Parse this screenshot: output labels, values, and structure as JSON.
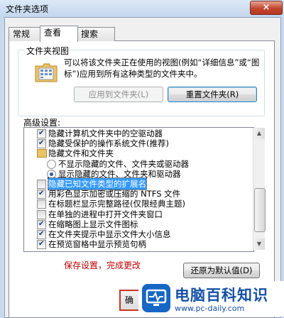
{
  "window": {
    "title": "文件夹选项",
    "close_label": "×"
  },
  "tabs": [
    {
      "label": "常规",
      "active": false
    },
    {
      "label": "查看",
      "active": true
    },
    {
      "label": "搜索",
      "active": false
    }
  ],
  "folder_views": {
    "label": "文件夹视图",
    "description": "可以将该文件夹正在使用的视图(例如“详细信息”或“图标”)应用到所有这种类型的文件夹中。",
    "apply_button": "应用到文件夹(L)",
    "reset_button": "重置文件夹(R)"
  },
  "advanced": {
    "label": "高级设置:",
    "items": [
      {
        "type": "checkbox",
        "checked": true,
        "level": 1,
        "label": "隐藏计算机文件夹中的空驱动器"
      },
      {
        "type": "checkbox",
        "checked": true,
        "level": 1,
        "label": "隐藏受保护的操作系统文件(推荐)"
      },
      {
        "type": "folder",
        "level": 1,
        "label": "隐藏文件和文件夹"
      },
      {
        "type": "radio",
        "checked": false,
        "level": 2,
        "label": "不显示隐藏的文件、文件夹或驱动器"
      },
      {
        "type": "radio",
        "checked": true,
        "level": 2,
        "label": "显示隐藏的文件、文件夹和驱动器"
      },
      {
        "type": "checkbox",
        "checked": false,
        "level": 1,
        "label": "隐藏已知文件类型的扩展名",
        "selected": true
      },
      {
        "type": "checkbox",
        "checked": true,
        "level": 1,
        "label": "用彩色显示加密或压缩的 NTFS 文件"
      },
      {
        "type": "checkbox",
        "checked": false,
        "level": 1,
        "label": "在标题栏显示完整路径(仅限经典主题)"
      },
      {
        "type": "checkbox",
        "checked": false,
        "level": 1,
        "label": "在单独的进程中打开文件夹窗口"
      },
      {
        "type": "checkbox",
        "checked": true,
        "level": 1,
        "label": "在缩略图上显示文件图标"
      },
      {
        "type": "checkbox",
        "checked": true,
        "level": 1,
        "label": "在文件夹提示中显示文件大小信息"
      },
      {
        "type": "checkbox",
        "checked": true,
        "level": 1,
        "label": "在预览窗格中显示预览句柄"
      }
    ],
    "scroll_position": 0.62
  },
  "annotation": "保存设置，完成更改",
  "restore_button": "还原为默认值(D)",
  "ok_button": "确",
  "watermark": {
    "title": "电脑百科知识",
    "url": "www.pc-daily.com"
  },
  "colors": {
    "selection": "#3399ff",
    "annotation": "#c00000",
    "watermark": "#1450a8"
  }
}
